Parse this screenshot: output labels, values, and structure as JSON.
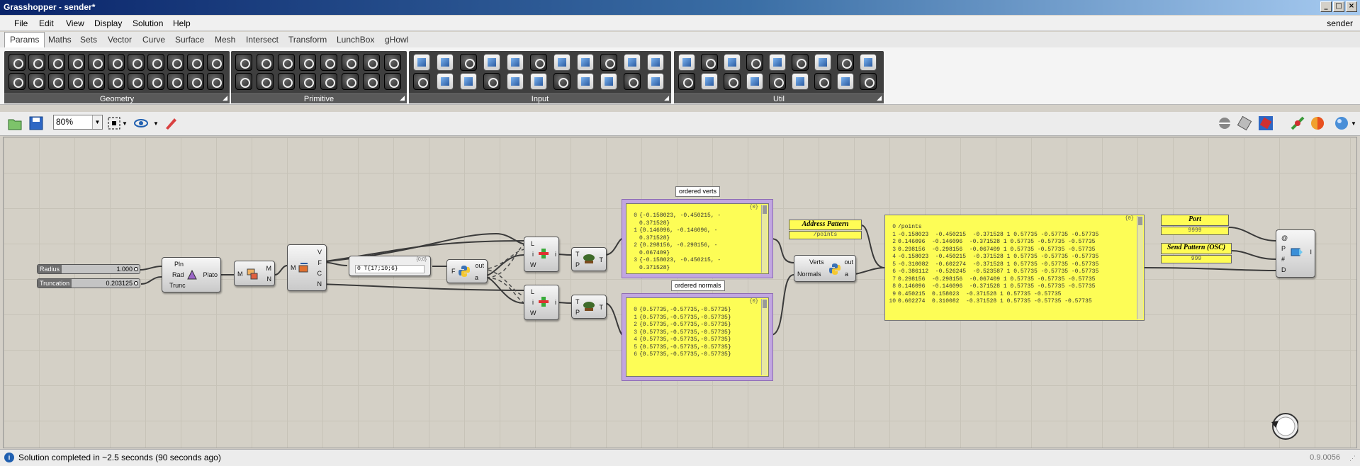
{
  "window": {
    "title": "Grasshopper - sender*",
    "user": "sender",
    "buttons": [
      "_",
      "□",
      "×"
    ]
  },
  "menu": [
    "File",
    "Edit",
    "View",
    "Display",
    "Solution",
    "Help"
  ],
  "tabs": [
    "Params",
    "Maths",
    "Sets",
    "Vector",
    "Curve",
    "Surface",
    "Mesh",
    "Intersect",
    "Transform",
    "LunchBox",
    "gHowl"
  ],
  "active_tab": "Params",
  "ribbon_groups": [
    "Geometry",
    "Primitive",
    "Input",
    "Util"
  ],
  "ribbon_icon_text": {
    "int": "0.1",
    "date": "20",
    "date_month": "AUG",
    "xyz": "XYZ",
    "pdb": "PDB",
    "tdm": "3DM",
    "img": "IMG",
    "shp": "SHP",
    "id": "ID",
    "seven": "7",
    "a": "A",
    "cf": "C/",
    "abc": "ABC"
  },
  "toolbar": {
    "zoom": "80%"
  },
  "components": {
    "radius": {
      "label": "Radius",
      "value": "1.000",
      "fraction": 1.0
    },
    "truncation": {
      "label": "Truncation",
      "value": "0.203125",
      "fraction": 0.203125
    },
    "plato": {
      "inputs": [
        "Pln",
        "Rad",
        "Trunc"
      ],
      "output": "Plato"
    },
    "mesh_conv": {
      "input": "M",
      "outputs": [
        "M",
        "N"
      ]
    },
    "deconstruct": {
      "input": "M",
      "outputs": [
        "V",
        "F",
        "C",
        "N"
      ]
    },
    "face_param": {
      "tree": "{0;0}",
      "text": "0 T{17;10;6}"
    },
    "python1": {
      "input": "F",
      "outputs": [
        "out",
        "a"
      ]
    },
    "list_item1": {
      "inputs": [
        "L",
        "i",
        "W"
      ],
      "output": "i"
    },
    "list_item2": {
      "inputs": [
        "L",
        "i",
        "W"
      ],
      "output": "i"
    },
    "flatten1": {
      "inputs": [
        "T",
        "P"
      ],
      "output": "T"
    },
    "flatten2": {
      "inputs": [
        "T",
        "P"
      ],
      "output": "T"
    },
    "python2": {
      "inputs": [
        "Verts",
        "Normals"
      ],
      "outputs": [
        "out",
        "a"
      ]
    },
    "udp": {
      "inputs": [
        "@",
        "P",
        "#",
        "D"
      ],
      "output": "I"
    }
  },
  "panels": {
    "ordered_verts": {
      "label": "ordered verts",
      "tree": "{0}",
      "rows": [
        {
          "i": "0",
          "t": "{-0.158023, -0.450215, -"
        },
        {
          "i": "",
          "t": "0.371528}"
        },
        {
          "i": "1",
          "t": "{0.146096, -0.146096, -"
        },
        {
          "i": "",
          "t": "0.371528}"
        },
        {
          "i": "2",
          "t": "{0.298156, -0.298156, -"
        },
        {
          "i": "",
          "t": "0.067409}"
        },
        {
          "i": "3",
          "t": "{-0.158023, -0.450215, -"
        },
        {
          "i": "",
          "t": "0.371528}"
        }
      ]
    },
    "ordered_normals": {
      "label": "ordered normals",
      "tree": "{0}",
      "rows": [
        {
          "i": "0",
          "t": "{0.57735,-0.57735,-0.57735}"
        },
        {
          "i": "1",
          "t": "{0.57735,-0.57735,-0.57735}"
        },
        {
          "i": "2",
          "t": "{0.57735,-0.57735,-0.57735}"
        },
        {
          "i": "3",
          "t": "{0.57735,-0.57735,-0.57735}"
        },
        {
          "i": "4",
          "t": "{0.57735,-0.57735,-0.57735}"
        },
        {
          "i": "5",
          "t": "{0.57735,-0.57735,-0.57735}"
        },
        {
          "i": "6",
          "t": "{0.57735,-0.57735,-0.57735}"
        }
      ]
    },
    "output": {
      "tree": "{0}",
      "rows": [
        {
          "i": "0",
          "t": "/points"
        },
        {
          "i": "1",
          "t": "-0.158023  -0.450215  -0.371528 1 0.57735 -0.57735 -0.57735"
        },
        {
          "i": "2",
          "t": "0.146096  -0.146096  -0.371528 1 0.57735 -0.57735 -0.57735"
        },
        {
          "i": "3",
          "t": "0.298156  -0.298156  -0.067409 1 0.57735 -0.57735 -0.57735"
        },
        {
          "i": "4",
          "t": "-0.158023  -0.450215  -0.371528 1 0.57735 -0.57735 -0.57735"
        },
        {
          "i": "5",
          "t": "-0.310082  -0.602274  -0.371528 1 0.57735 -0.57735 -0.57735"
        },
        {
          "i": "6",
          "t": "-0.386112  -0.526245  -0.523587 1 0.57735 -0.57735 -0.57735"
        },
        {
          "i": "7",
          "t": "0.298156  -0.298156  -0.067409 1 0.57735 -0.57735 -0.57735"
        },
        {
          "i": "8",
          "t": "0.146096  -0.146096  -0.371528 1 0.57735 -0.57735 -0.57735"
        },
        {
          "i": "9",
          "t": "0.450215  0.158023  -0.371528 1 0.57735 -0.57735"
        },
        {
          "i": "10",
          "t": "0.602274  0.310082  -0.371528 1 0.57735 -0.57735 -0.57735"
        }
      ]
    }
  },
  "address_pattern": {
    "label": "Address Pattern",
    "value": "/points"
  },
  "port": {
    "label": "Port",
    "value": "9999"
  },
  "send_pattern": {
    "label": "Send Pattern (OSC)",
    "value": "999"
  },
  "status": {
    "text": "Solution completed in ~2.5 seconds (90 seconds ago)",
    "version": "0.9.0056"
  },
  "colors": {
    "panel_yellow": "#fdfd56",
    "selection_purple": "#c1a6e0",
    "canvas": "#d4d0c6",
    "titlebar": "#0a246a"
  }
}
